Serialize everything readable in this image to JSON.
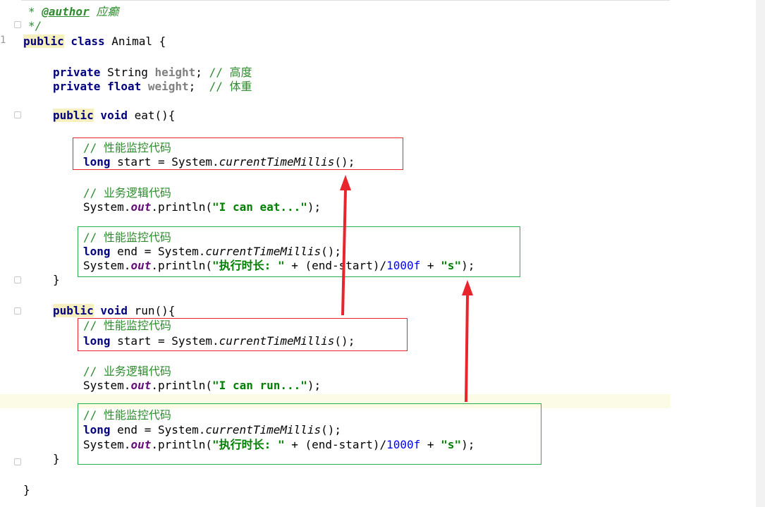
{
  "editor": {
    "lines": {
      "l1": {
        "star": "* ",
        "tag": "@author",
        "name": " 应癫"
      },
      "l2": {
        "text": "*/"
      },
      "l3": {
        "kw1": "public",
        "kw2": " class",
        "rest": " Animal {"
      },
      "l5": {
        "kw": "private",
        "t": " String ",
        "f": "height",
        "semi": "; ",
        "c": "// 高度"
      },
      "l6": {
        "kw": "private",
        "kw2": " float",
        "sp": " ",
        "f": "weight",
        "semi": ";  ",
        "c": "// 体重"
      },
      "l8": {
        "kw1": "public",
        "kw2": " void",
        "rest": " eat(){"
      },
      "l10": {
        "c": "// 性能监控代码"
      },
      "l11": {
        "kw": "long",
        "rest": " start = System.",
        "m": "currentTimeMillis",
        "end": "();"
      },
      "l13": {
        "c": "// 业务逻辑代码"
      },
      "l14": {
        "a": "System.",
        "o": "out",
        "b": ".println(",
        "s": "\"I can eat...\"",
        "e": ");"
      },
      "l16": {
        "c": "// 性能监控代码"
      },
      "l17": {
        "kw": "long",
        "rest": " end = System.",
        "m": "currentTimeMillis",
        "end": "();"
      },
      "l18": {
        "a": "System.",
        "o": "out",
        "b": ".println(",
        "s": "\"执行时长: \"",
        "mid": " + (end-start)/",
        "n": "1000f",
        "p": " + ",
        "s2": "\"s\"",
        "e": ");"
      },
      "l19": {
        "text": "}"
      },
      "l21": {
        "kw1": "public",
        "kw2": " void",
        "rest": " run(){"
      },
      "l22": {
        "c": "// 性能监控代码"
      },
      "l23": {
        "kw": "long",
        "rest": " start = System.",
        "m": "currentTimeMillis",
        "end": "();"
      },
      "l25": {
        "c": "// 业务逻辑代码"
      },
      "l26": {
        "a": "System.",
        "o": "out",
        "b": ".println(",
        "s": "\"I can run...\"",
        "e": ");"
      },
      "l28": {
        "c": "// 性能监控代码"
      },
      "l29": {
        "kw": "long",
        "rest": " end = System.",
        "m": "currentTimeMillis",
        "end": "();"
      },
      "l30": {
        "a": "System.",
        "o": "out",
        "b": ".println(",
        "s": "\"执行时长: \"",
        "mid": " + (end-start)/",
        "n": "1000f",
        "p": " + ",
        "s2": "\"s\"",
        "e": ");"
      },
      "l31": {
        "text": "}"
      },
      "l33": {
        "text": "}"
      }
    },
    "gutter_number": "1"
  },
  "colors": {
    "red_box": "#e8242c",
    "green_box": "#22b14c",
    "arrow": "#e8242c",
    "current_line": "#fcfbe6"
  }
}
